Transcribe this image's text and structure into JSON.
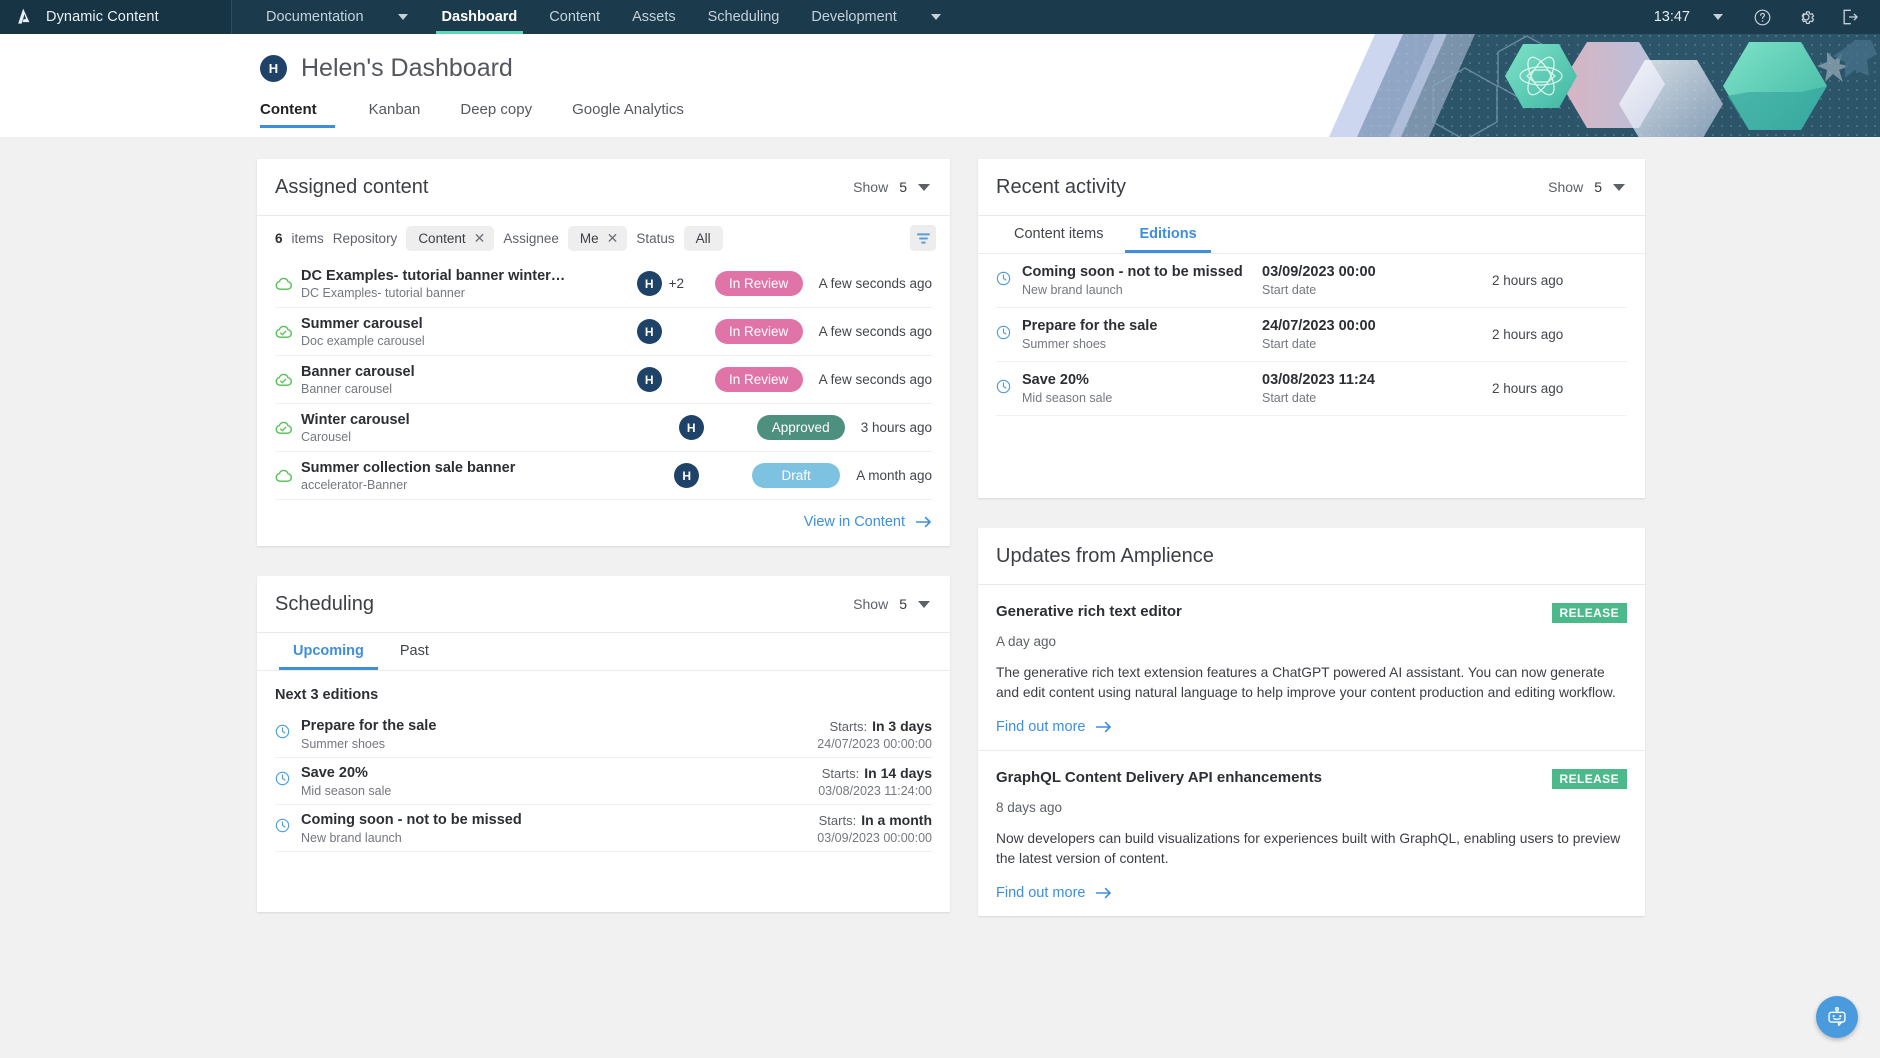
{
  "topnav": {
    "brand": "Dynamic Content",
    "items": [
      {
        "label": "Documentation",
        "active": false,
        "caret": true
      },
      {
        "label": "Dashboard",
        "active": true,
        "caret": false
      },
      {
        "label": "Content",
        "active": false,
        "caret": false
      },
      {
        "label": "Assets",
        "active": false,
        "caret": false
      },
      {
        "label": "Scheduling",
        "active": false,
        "caret": false
      },
      {
        "label": "Development",
        "active": false,
        "caret": true
      }
    ],
    "clock": "13:47",
    "icons": [
      "chevron-down-icon",
      "help-icon",
      "gear-icon",
      "logout-icon"
    ]
  },
  "header": {
    "avatar_initial": "H",
    "title": "Helen's Dashboard",
    "tabs": [
      {
        "label": "Content",
        "active": true
      },
      {
        "label": "Kanban",
        "active": false
      },
      {
        "label": "Deep copy",
        "active": false
      },
      {
        "label": "Google Analytics",
        "active": false
      }
    ]
  },
  "assigned": {
    "title": "Assigned content",
    "show_label": "Show",
    "show_value": "5",
    "filter": {
      "count": "6",
      "count_suffix": "items",
      "repository_label": "Repository",
      "repository_value": "Content",
      "assignee_label": "Assignee",
      "assignee_value": "Me",
      "status_label": "Status",
      "status_value": "All",
      "remove_glyph": "✕"
    },
    "rows": [
      {
        "icon": "cloud-icon",
        "title": "DC Examples- tutorial banner winter co...",
        "sub": "DC Examples- tutorial banner",
        "avatar": "H",
        "extra": "+2",
        "status": "In Review",
        "status_color": "#e074a8",
        "time": "A few seconds ago"
      },
      {
        "icon": "cloud-check-icon",
        "title": "Summer carousel",
        "sub": "Doc example carousel",
        "avatar": "H",
        "extra": "",
        "status": "In Review",
        "status_color": "#e074a8",
        "time": "A few seconds ago"
      },
      {
        "icon": "cloud-check-icon",
        "title": "Banner carousel",
        "sub": "Banner carousel",
        "avatar": "H",
        "extra": "",
        "status": "In Review",
        "status_color": "#e074a8",
        "time": "A few seconds ago"
      },
      {
        "icon": "cloud-check-icon",
        "title": "Winter carousel",
        "sub": "Carousel",
        "avatar": "H",
        "extra": "",
        "status": "Approved",
        "status_color": "#4e9080",
        "time": "3 hours ago"
      },
      {
        "icon": "cloud-icon",
        "title": "Summer collection sale banner",
        "sub": "accelerator-Banner",
        "avatar": "H",
        "extra": "",
        "status": "Draft",
        "status_color": "#7dc2e0",
        "time": "A month ago"
      }
    ],
    "footer_link": "View in Content"
  },
  "activity": {
    "title": "Recent activity",
    "show_label": "Show",
    "show_value": "5",
    "tabs": [
      {
        "label": "Content items",
        "active": false
      },
      {
        "label": "Editions",
        "active": true
      }
    ],
    "rows": [
      {
        "icon": "clock-icon",
        "name": "Coming soon - not to be missed",
        "sub": "New brand launch",
        "date": "03/09/2023 00:00",
        "date_label": "Start date",
        "ago": "2 hours ago"
      },
      {
        "icon": "clock-icon",
        "name": "Prepare for the sale",
        "sub": "Summer shoes",
        "date": "24/07/2023 00:00",
        "date_label": "Start date",
        "ago": "2 hours ago"
      },
      {
        "icon": "clock-icon",
        "name": "Save 20%",
        "sub": "Mid season sale",
        "date": "03/08/2023 11:24",
        "date_label": "Start date",
        "ago": "2 hours ago"
      }
    ]
  },
  "scheduling": {
    "title": "Scheduling",
    "show_label": "Show",
    "show_value": "5",
    "tabs": [
      {
        "label": "Upcoming",
        "active": true
      },
      {
        "label": "Past",
        "active": false
      }
    ],
    "subheading": "Next 3 editions",
    "rows": [
      {
        "icon": "clock-icon",
        "name": "Prepare for the sale",
        "sub": "Summer shoes",
        "starts_label": "Starts:",
        "starts_value": "In 3 days",
        "datetime": "24/07/2023 00:00:00"
      },
      {
        "icon": "clock-icon",
        "name": "Save 20%",
        "sub": "Mid season sale",
        "starts_label": "Starts:",
        "starts_value": "In 14 days",
        "datetime": "03/08/2023 11:24:00"
      },
      {
        "icon": "clock-icon",
        "name": "Coming soon - not to be missed",
        "sub": "New brand launch",
        "starts_label": "Starts:",
        "starts_value": "In a month",
        "datetime": "03/09/2023 00:00:00"
      }
    ]
  },
  "updates": {
    "title": "Updates from Amplience",
    "items": [
      {
        "title": "Generative rich text editor",
        "tag": "RELEASE",
        "age": "A day ago",
        "body": "The generative rich text extension features a ChatGPT powered AI assistant. You can now generate and edit content using natural language to help improve your content production and editing workflow.",
        "link": "Find out more"
      },
      {
        "title": "GraphQL Content Delivery API enhancements",
        "tag": "RELEASE",
        "age": "8 days ago",
        "body": "Now developers can build visualizations for experiences built with GraphQL, enabling users to preview the latest version of content.",
        "link": "Find out more"
      }
    ],
    "tag_color": "#4cb98b"
  },
  "chatbot": {
    "icon": "chatbot-icon"
  },
  "colors": {
    "nav_bg": "#1b3a4b",
    "nav_active_underline": "#5fd6b4",
    "accent_blue": "#3e8ede",
    "avatar_navy": "#1f4268",
    "status_review": "#e074a8",
    "status_approved": "#4e9080",
    "status_draft": "#7dc2e0",
    "release_tag": "#4cb98b",
    "page_bg": "#f1f1f1"
  }
}
